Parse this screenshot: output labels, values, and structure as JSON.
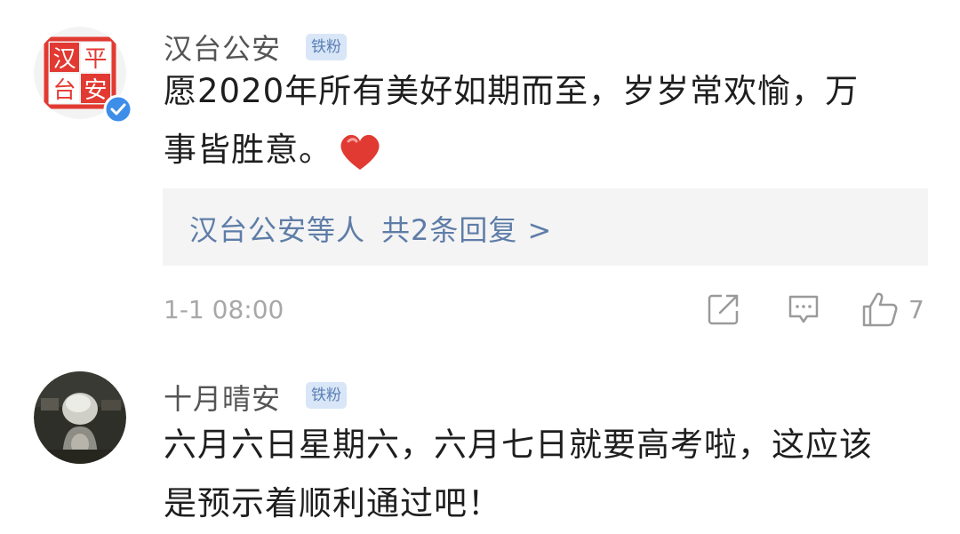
{
  "comments": [
    {
      "username": "汉台公安",
      "badge": "铁粉",
      "avatar_chars": [
        "汉",
        "平",
        "台",
        "安"
      ],
      "content_line1": "愿2020年所有美好如期而至，岁岁常欢愉，万",
      "content_line2": "事皆胜意。",
      "reply_prefix": "汉台公安等人",
      "reply_count": "共2条回复 >",
      "timestamp": "1-1 08:00",
      "like_count": "7",
      "colors": {
        "seal_red": "#e23a32",
        "verified_blue": "#3d8ee8",
        "heart_red": "#e03a32"
      }
    },
    {
      "username": "十月晴安",
      "badge": "铁粉",
      "content_line1": "六月六日星期六，六月七日就要高考啦，这应该",
      "content_line2": "是预示着顺利通过吧！"
    }
  ],
  "icons": {
    "share": "share-icon",
    "comment": "comment-icon",
    "like": "thumbs-up-icon",
    "verified": "verified-check-icon",
    "heart": "heart-icon"
  },
  "colors": {
    "link": "#5e7da8",
    "badge_bg": "#d8e6f7",
    "badge_text": "#5b7fb5",
    "reply_bg": "#f4f4f4",
    "meta_gray": "#a8a8a8"
  }
}
